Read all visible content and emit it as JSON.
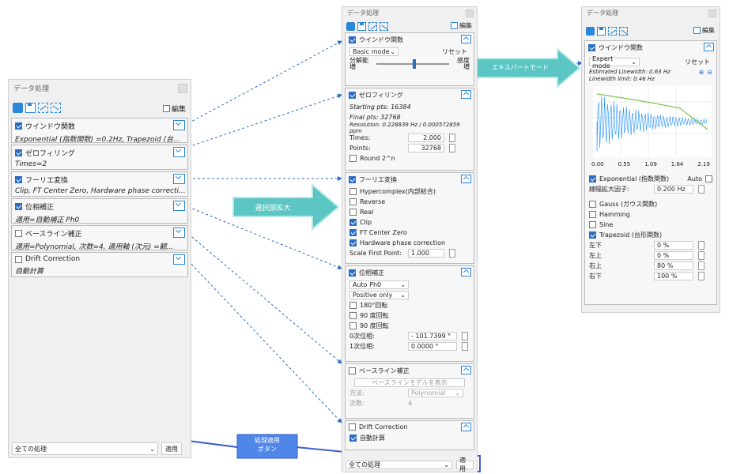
{
  "left": {
    "title": "データ処理",
    "edit": "編集",
    "sections": [
      {
        "label": "ウインドウ関数",
        "sub": "Exponential (指数関数) =0.2Hz, Trapezoid (台...",
        "on": true
      },
      {
        "label": "ゼロフィリング",
        "sub": "Times=2",
        "on": true
      },
      {
        "label": "フーリエ変換",
        "sub": "Clip, FT Center Zero, Hardware phase correcti...",
        "on": true
      },
      {
        "label": "位相補正",
        "sub": "適用=自動補正 Ph0",
        "on": true
      },
      {
        "label": "ベースライン補正",
        "sub": "適用=Polynomial, 次数=4, 適用軸 (次元) =観...",
        "on": false
      },
      {
        "label": "Drift Correction",
        "sub": "自動計算",
        "on": false
      }
    ],
    "all": "全ての処理",
    "apply": "適用"
  },
  "mid": {
    "title": "データ処理",
    "edit": "編集",
    "win": {
      "label": "ウインドウ関数",
      "mode": "Basic mode",
      "reset": "リセット",
      "res_l": "分解能",
      "res_l2": "増",
      "sen": "感度",
      "sen2": "増"
    },
    "zf": {
      "label": "ゼロフィリング",
      "start": "Starting pts: 16384",
      "final": "Final pts: 32768",
      "resol": "Resolution: 0.228839 Hz / 0.000572859 ppm",
      "times_l": "Times:",
      "times": "2.000",
      "points_l": "Points:",
      "points": "32768",
      "round": "Round 2^n"
    },
    "ft": {
      "label": "フーリエ変換",
      "hyper": "Hypercomplex(内部結合)",
      "reverse": "Reverse",
      "real": "Real",
      "clip": "Clip",
      "center": "FT Center Zero",
      "hw": "Hardware phase correction",
      "sfp_l": "Scale First Point:",
      "sfp": "1.000"
    },
    "ph": {
      "label": "位相補正",
      "auto": "Auto Ph0",
      "pos": "Positive only",
      "r180": "180°回転",
      "r90a": "90 度回転",
      "r90b": "90 度回転",
      "ph0_l": "0次位相:",
      "ph0": "- 101.7399 °",
      "ph1_l": "1次位相:",
      "ph1": "0.0000 °"
    },
    "bl": {
      "label": "ベースライン補正",
      "show": "ベースラインモデルを表示",
      "method_l": "方法:",
      "method": "Polynomial",
      "order_l": "次数:",
      "order": "4"
    },
    "dc": {
      "label": "Drift Correction",
      "auto": "自動計算"
    },
    "all": "全ての処理",
    "apply": "適用"
  },
  "right": {
    "title": "データ処理",
    "edit": "編集",
    "win": "ウインドウ関数",
    "mode": "Expert mode",
    "reset": "リセット",
    "est": "Estimated Linewidth: 0.63 Hz",
    "lim": "Linewidth limit: 0.46 Hz",
    "ticks": [
      "0.00",
      "0.55",
      "1.09",
      "1.64",
      "2.19"
    ],
    "exp": "Exponential (指数関数)",
    "autol": "Auto",
    "lb_l": "線幅拡大因子:",
    "lb": "0.200 Hz",
    "gauss": "Gauss (ガウス関数)",
    "hamming": "Hamming",
    "sine": "Sine",
    "trap": "Trapezoid (台形関数)",
    "ll": "左下",
    "lu": "左上",
    "ru": "右上",
    "rl": "右下",
    "llv": "0 %",
    "luv": "0 %",
    "ruv": "80 %",
    "rlv": "100 %"
  },
  "callouts": {
    "expand": "選択部拡大",
    "expert": "エキスパートモード",
    "apply": "処理適用\nボタン"
  }
}
